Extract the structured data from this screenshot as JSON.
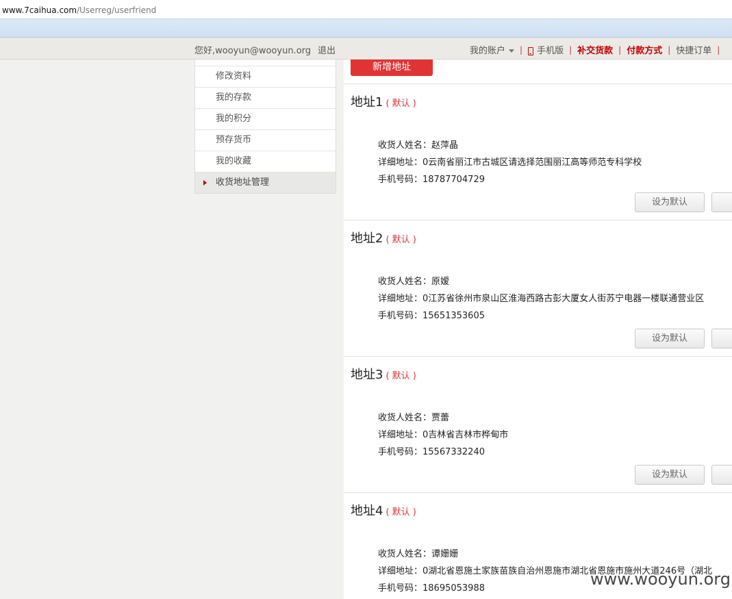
{
  "browser": {
    "url_host": "www.7caihua.com",
    "url_path": "/Userreg/userfriend"
  },
  "topnav": {
    "greeting": "您好,wooyun@wooyun.org",
    "logout": "退出",
    "my_account": "我的账户",
    "mobile": "手机版",
    "pay_balance": "补交货款",
    "payment_method": "付款方式",
    "quick_order": "快捷订单"
  },
  "sidebar": {
    "items": [
      {
        "label": "修改资料"
      },
      {
        "label": "我的存款"
      },
      {
        "label": "我的积分"
      },
      {
        "label": "预存货币"
      },
      {
        "label": "我的收藏"
      },
      {
        "label": "收货地址管理",
        "active": true
      }
    ]
  },
  "main": {
    "add_button": "新增地址",
    "default_tag": "( 默认 )",
    "set_default_label": "设为默认",
    "addresses": [
      {
        "title": "地址1",
        "name": "收货人姓名：赵萍晶",
        "detail": "详细地址：0云南省丽江市古城区请选择范围丽江高等师范专科学校",
        "phone": "手机号码：18787704729"
      },
      {
        "title": "地址2",
        "name": "收货人姓名：原嫒",
        "detail": "详细地址：0江苏省徐州市泉山区淮海西路古彭大厦女人街苏宁电器一楼联通营业区",
        "phone": "手机号码：15651353605"
      },
      {
        "title": "地址3",
        "name": "收货人姓名：贾蕾",
        "detail": "详细地址：0吉林省吉林市桦甸市",
        "phone": "手机号码：15567332240"
      },
      {
        "title": "地址4",
        "name": "收货人姓名：谭姗姗",
        "detail": "详细地址：0湖北省恩施土家族苗族自治州恩施市湖北省恩施市施州大道246号（湖北",
        "phone": "手机号码：18695053988"
      }
    ]
  },
  "watermark": "www.wooyun.org"
}
